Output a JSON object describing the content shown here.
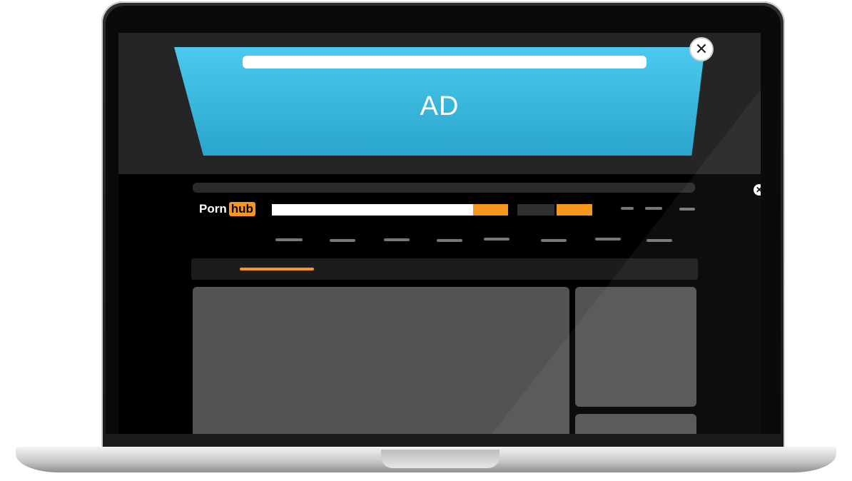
{
  "ad": {
    "label": "AD",
    "close_glyph": "✕"
  },
  "site": {
    "logo_part1": "Porn",
    "logo_part2": "hub",
    "close_glyph": "✕"
  },
  "icons": {
    "ad_close": "close-icon",
    "page_close": "close-icon"
  },
  "colors": {
    "ad_blue": "#3bb8e0",
    "brand_orange": "#f7971e",
    "placeholder_gray": "#535353"
  }
}
